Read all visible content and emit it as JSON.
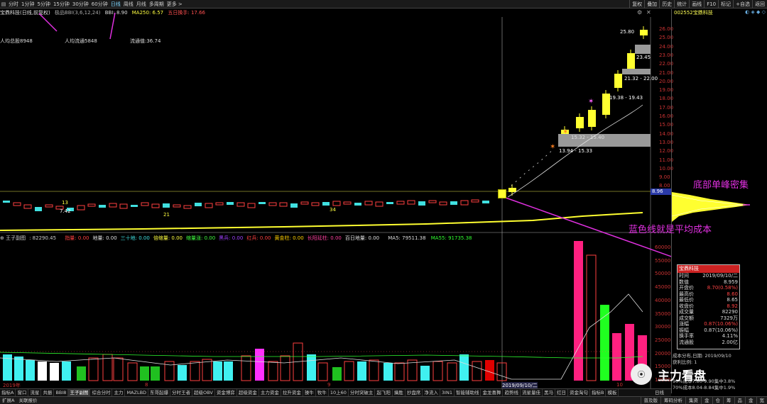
{
  "toolbar": {
    "menu_icon": "▤",
    "timeframes": [
      "分时",
      "1分钟",
      "5分钟",
      "15分钟",
      "30分钟",
      "60分钟",
      "日线",
      "周线",
      "月线",
      "多周期",
      "更多 >"
    ],
    "active_timeframe_index": 6,
    "right_buttons": [
      "复权",
      "叠加",
      "历史",
      "统计",
      "画线",
      "F10",
      "标记",
      "+自选",
      "返回"
    ],
    "stock_code_name": "002552宝鼎科技"
  },
  "indicator_line": {
    "stock_label": "宝鼎科技(日线,前复权)",
    "bbi_label": "极品BBI(3,6,12,24)",
    "bbi_value": "BBI: 8.90",
    "ma250": "MA250: 6.57",
    "five_day": "五日换手: 17.66"
  },
  "stats": {
    "avg_total": "人均总股8948",
    "avg_float": "人均流通5848",
    "float_value": "流通值:36.74"
  },
  "price_axis": [
    "26.00",
    "25.00",
    "24.00",
    "23.00",
    "22.00",
    "21.00",
    "20.00",
    "19.00",
    "18.00",
    "17.00",
    "16.00",
    "15.00",
    "14.00",
    "13.00",
    "12.00",
    "11.00",
    "10.00",
    "9.00",
    "8.00"
  ],
  "current_price_tag": "8.96",
  "price_labels": {
    "high": "25.80",
    "p1": "23.45",
    "p2": "21.32 - 22.00",
    "p3": "19.38 - 19.43",
    "p4": "15.32 - 15.40",
    "p5": "13.94 - 15.33",
    "low": "7.42",
    "num13": "13",
    "num21": "21",
    "num34": "34"
  },
  "volume_indicator": {
    "name": "王子副图",
    "value": ": 82290.45",
    "flags": [
      {
        "text": "指量: 0.00",
        "color": "#ff4040"
      },
      {
        "text": "地量: 0.00",
        "color": "#e0e0e0"
      },
      {
        "text": "三十地: 0.00",
        "color": "#40e0e0"
      },
      {
        "text": "倍缩量: 0.00",
        "color": "#ffff40"
      },
      {
        "text": "缩量涨: 0.00",
        "color": "#40ff40"
      },
      {
        "text": "黑兵: 0.00",
        "color": "#a040ff"
      },
      {
        "text": "红兵: 0.00",
        "color": "#ff4040"
      },
      {
        "text": "黄金柱: 0.00",
        "color": "#ffd000"
      },
      {
        "text": "长阳延柱: 0.00",
        "color": "#ff40a0"
      },
      {
        "text": "百日地量: 0.00",
        "color": "#e0e0e0"
      }
    ],
    "ma5": "MA5: 79511.38",
    "ma55": "MA55: 91735.38"
  },
  "volume_axis": [
    "60000",
    "55000",
    "50000",
    "45000",
    "40000",
    "35000",
    "30000",
    "25000",
    "20000",
    "15000",
    "10000"
  ],
  "dates": {
    "left": "2019年",
    "mid1": "8",
    "mid2": "9",
    "cursor": "2019/09/10/二",
    "right": "10"
  },
  "popup": {
    "title": "宝鼎科技",
    "rows": [
      {
        "k": "时间",
        "v": "2019/09/10/二",
        "red": false
      },
      {
        "k": "数值",
        "v": "8.959",
        "red": false
      },
      {
        "k": "开盘价",
        "v": "8.70(0.58%)",
        "red": true
      },
      {
        "k": "最高价",
        "v": "8.60",
        "red": true
      },
      {
        "k": "最低价",
        "v": "8.65",
        "red": false
      },
      {
        "k": "收盘价",
        "v": "8.92",
        "red": true
      },
      {
        "k": "成交量",
        "v": "82290",
        "red": false
      },
      {
        "k": "成交额",
        "v": "7329万",
        "red": false
      },
      {
        "k": "涨幅",
        "v": "0.87(10.06%)",
        "red": true
      },
      {
        "k": "振幅",
        "v": "0.87(10.06%)",
        "red": false
      },
      {
        "k": "换手率",
        "v": "4.11%",
        "red": false
      },
      {
        "k": "流通股",
        "v": "2.00亿",
        "red": false
      }
    ]
  },
  "cost": {
    "line1": "成本分布,日期: 2019/09/10",
    "line2": "获利比例: 1",
    "line3": "90%成本7.80-9.90集中3.8%",
    "line4": "70%成本8.04-8.84集中1.9%"
  },
  "annotations": {
    "bottom_peak": "底部单峰密集",
    "blue_line": "蓝色线就是平均成本"
  },
  "watermark": {
    "logo": "⦿",
    "text": "主力看盘"
  },
  "tabs": [
    "指标A",
    "窗口",
    "流星",
    "共振",
    "BBI8",
    "王子副图",
    "综合分时",
    "主力",
    "MAZLBD",
    "东哥起爆",
    "分时王者",
    "超级OBV",
    "资金博弈",
    "超级资金",
    "主力资金",
    "拉升资金",
    "操牛",
    "牧牛",
    "10上60",
    "分时突破主",
    "起飞阳",
    "擒胜",
    "抄盘席",
    "净流入",
    "3IN1",
    "智能辅助线",
    "金龙喜舞",
    "趋势线",
    "流星量佳",
    "黑马",
    "红日",
    "资金淘句",
    "指标B",
    "模板"
  ],
  "active_tab_index": 5,
  "right_tab": "日线",
  "status": {
    "left": [
      "扩展A",
      "关联报价"
    ],
    "right_items": [
      "普及版",
      "筹码分析",
      "集资",
      "金",
      "仓",
      "筹",
      "品",
      "金",
      "宽"
    ]
  }
}
